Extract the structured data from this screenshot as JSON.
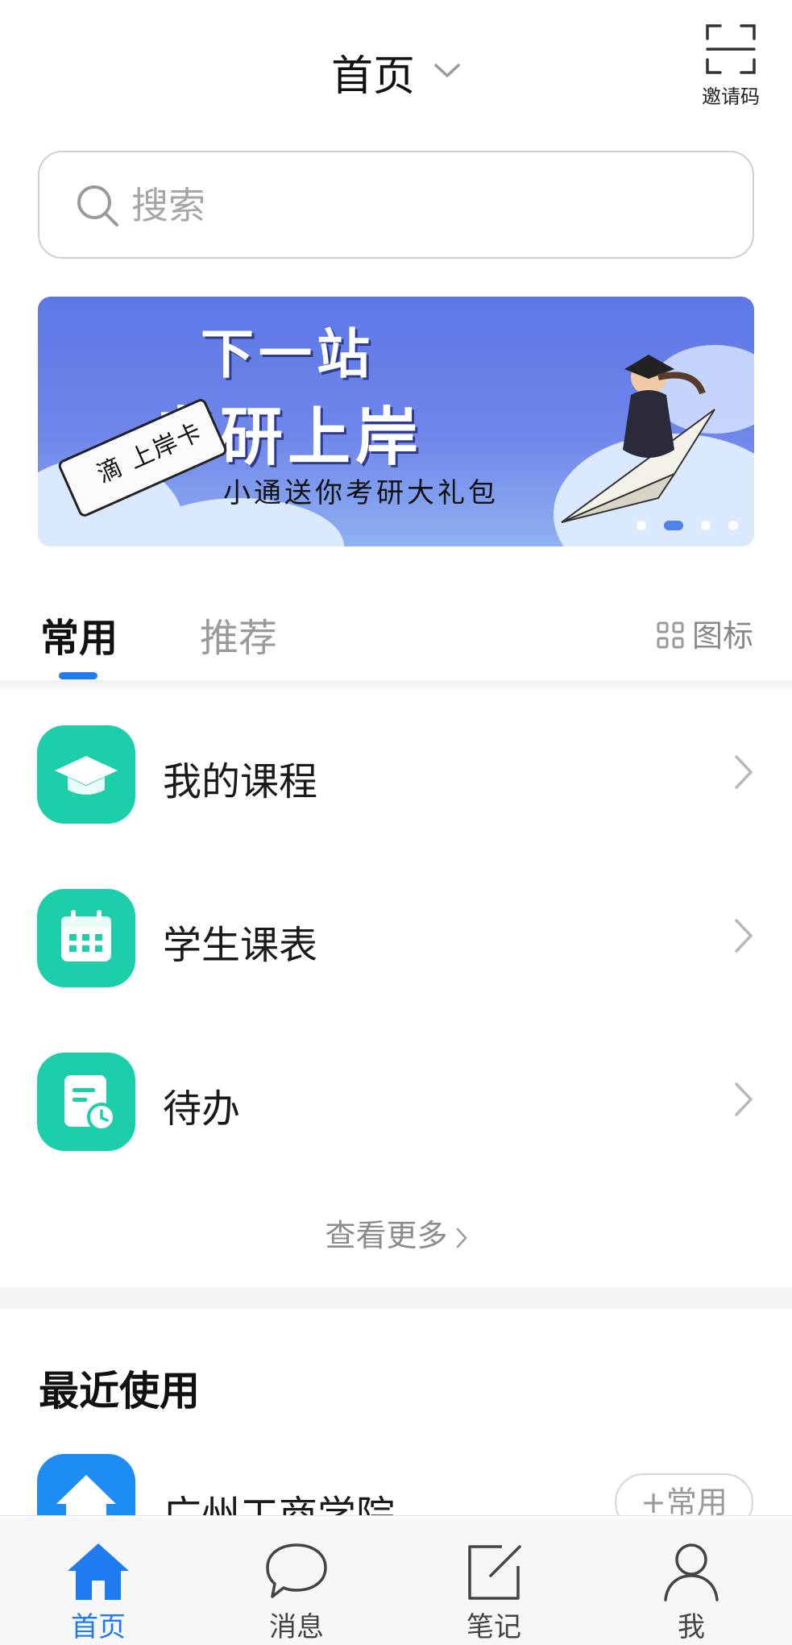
{
  "header": {
    "title": "首页",
    "invite_label": "邀请码"
  },
  "search": {
    "placeholder": "搜索"
  },
  "banner": {
    "line1": "下一站",
    "line2": "考研上岸",
    "subtitle": "小通送你考研大礼包",
    "ticket_text": "滴 上岸卡",
    "slide_count": 4,
    "active_slide": 2
  },
  "tabs": {
    "items": [
      "常用",
      "推荐"
    ],
    "active": "常用",
    "view_toggle_label": "图标"
  },
  "common_apps": [
    {
      "label": "我的课程",
      "icon": "graduation-cap-icon"
    },
    {
      "label": "学生课表",
      "icon": "calendar-icon"
    },
    {
      "label": "待办",
      "icon": "todo-clock-icon"
    }
  ],
  "more_label": "查看更多",
  "recent": {
    "title": "最近使用",
    "items": [
      {
        "label": "广州工商学院",
        "action_label": "+常用",
        "icon": "home-icon"
      }
    ]
  },
  "bottom_nav": {
    "items": [
      {
        "label": "首页",
        "icon": "home-icon",
        "active": true
      },
      {
        "label": "消息",
        "icon": "chat-bubble-icon",
        "active": false
      },
      {
        "label": "笔记",
        "icon": "note-edit-icon",
        "active": false
      },
      {
        "label": "我",
        "icon": "person-icon",
        "active": false
      }
    ]
  },
  "colors": {
    "accent": "#1e7cf0",
    "app_icon_teal": "#1ccfaa",
    "banner_blue": "#5d78e6"
  }
}
